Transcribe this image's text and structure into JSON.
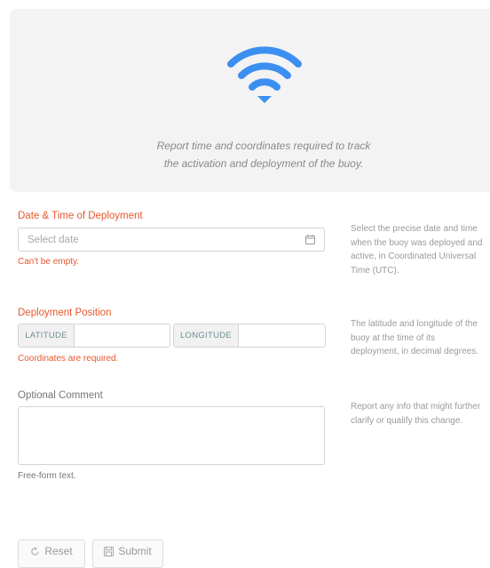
{
  "hero": {
    "icon": "wifi-icon",
    "icon_color": "#3b8ff0",
    "description_line1": "Report time and coordinates required to track",
    "description_line2": "the activation and deployment of the buoy."
  },
  "deployment_date": {
    "label": "Date & Time of Deployment",
    "placeholder": "Select date",
    "value": "",
    "error": "Can't be empty.",
    "help": "Select the precise date and time when the buoy was deployed and active, in Coordinated Universal Time (UTC).",
    "icon": "calendar-icon"
  },
  "position": {
    "label": "Deployment Position",
    "latitude_addon": "LATITUDE",
    "latitude_value": "",
    "longitude_addon": "LONGITUDE",
    "longitude_value": "",
    "error": "Coordinates are required.",
    "help": "The latitude and longitude of the buoy at the time of its deployment, in decimal degrees."
  },
  "comment": {
    "label": "Optional Comment",
    "value": "",
    "hint": "Free-form text.",
    "help": "Report any info that might further clarify or qualify this change."
  },
  "buttons": {
    "reset_label": "Reset",
    "submit_label": "Submit"
  },
  "colors": {
    "error": "#e5582e",
    "hero_bg": "#f3f3f4",
    "addon_text": "#6f8e92"
  }
}
